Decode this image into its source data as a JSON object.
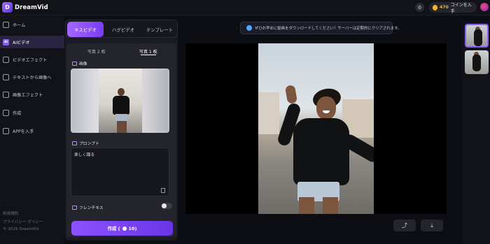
{
  "app": {
    "logo_mark": "D",
    "name": "DreamVid"
  },
  "header": {
    "credits": "470",
    "credits_action": "コインを入手"
  },
  "sidebar": {
    "items": [
      {
        "label": "ホーム",
        "icon": "home-icon"
      },
      {
        "label": "AIビデオ",
        "icon": "ai-video-icon",
        "badge": "AI",
        "active": true
      },
      {
        "label": "ビデオエフェクト",
        "icon": "video-effect-icon"
      },
      {
        "label": "テキストから画像へ",
        "icon": "text-to-image-icon"
      },
      {
        "label": "画像エフェクト",
        "icon": "image-effect-icon"
      },
      {
        "label": "作成",
        "icon": "create-icon"
      },
      {
        "label": "APPを入手",
        "icon": "app-icon"
      }
    ],
    "footer": [
      "利用規約",
      "プライバシー ポリシー",
      "© 2025 DreamVid"
    ]
  },
  "panel": {
    "tabs": [
      "キスビデオ",
      "ハグビデオ",
      "テンプレート"
    ],
    "active_tab": "キスビデオ",
    "photo_tabs": [
      "写真 2 枚",
      "写真 1 枚"
    ],
    "active_photo_tab": "写真 1 枚",
    "image_label": "画像",
    "prompt_label": "プロンプト",
    "prompt_value": "楽しく踊る",
    "french_kiss_label": "フレンチキス",
    "french_kiss_on": false,
    "create_label": "作成 (",
    "create_cost": "10)"
  },
  "notice": {
    "text": "ぜひお早めに動画をダウンロードしてください！サーバーは定期的にクリアされます。"
  },
  "preview": {
    "share_icon": "share-icon",
    "download_icon": "download-icon"
  },
  "history": {
    "thumbnails": 2
  },
  "colors": {
    "accent": "#8b5cf6",
    "coin": "#f3b52c",
    "background": "#0d0e13"
  }
}
